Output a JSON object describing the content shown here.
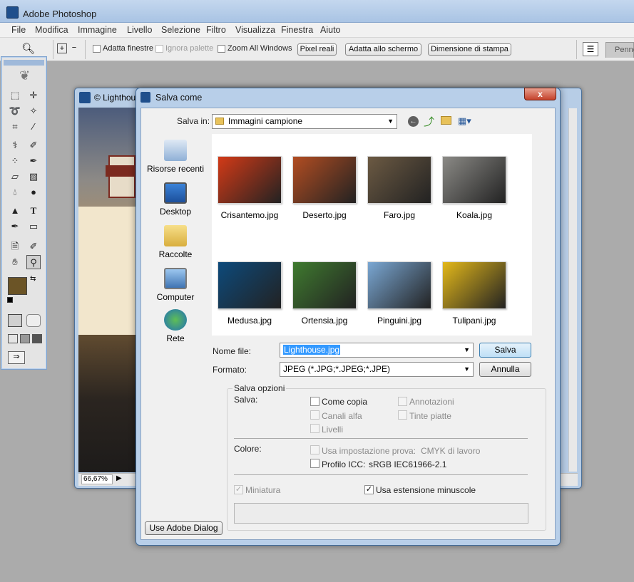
{
  "app": {
    "title": "Adobe Photoshop"
  },
  "menu": [
    "File",
    "Modifica",
    "Immagine",
    "Livello",
    "Selezione",
    "Filtro",
    "Visualizza",
    "Finestra",
    "Aiuto"
  ],
  "options": {
    "adatta_finestre": "Adatta finestre",
    "ignora_palette": "Ignora palette",
    "zoom_all": "Zoom All Windows",
    "pixel_reali": "Pixel reali",
    "adatta_schermo": "Adatta allo schermo",
    "dimensione_stampa": "Dimensione di stampa",
    "panel_tab": "Penne"
  },
  "document": {
    "title": "© Lighthou",
    "zoom": "66,67%"
  },
  "dialog": {
    "title": "Salva come",
    "save_in_label": "Salva in:",
    "save_in_value": "Immagini campione",
    "places": [
      "Risorse recenti",
      "Desktop",
      "Raccolte",
      "Computer",
      "Rete"
    ],
    "files": [
      {
        "name": "Crisantemo.jpg",
        "color": "#d33a17"
      },
      {
        "name": "Deserto.jpg",
        "color": "#b24d22"
      },
      {
        "name": "Faro.jpg",
        "color": "#6c5a43"
      },
      {
        "name": "Koala.jpg",
        "color": "#8b8a86"
      },
      {
        "name": "Medusa.jpg",
        "color": "#0d4a7b"
      },
      {
        "name": "Ortensia.jpg",
        "color": "#3f7a2f"
      },
      {
        "name": "Pinguini.jpg",
        "color": "#7aa7d3"
      },
      {
        "name": "Tulipani.jpg",
        "color": "#e3b81a"
      }
    ],
    "filename_label": "Nome file:",
    "filename_value": "Lighthouse.jpg",
    "format_label": "Formato:",
    "format_value": "JPEG (*.JPG;*.JPEG;*.JPE)",
    "save_button": "Salva",
    "cancel_button": "Annulla",
    "save_options_title": "Salva opzioni",
    "save_label": "Salva:",
    "come_copia": "Come copia",
    "annotazioni": "Annotazioni",
    "canali_alfa": "Canali alfa",
    "tinte_piatte": "Tinte piatte",
    "livelli": "Livelli",
    "colore_label": "Colore:",
    "usa_impostazione": "Usa impostazione prova:",
    "cmyk": "CMYK di lavoro",
    "profilo_icc": "Profilo ICC:",
    "profilo_value": "sRGB IEC61966-2.1",
    "miniatura": "Miniatura",
    "usa_estensione": "Usa estensione minuscole",
    "adobe_dialog_button": "Use Adobe Dialog",
    "close_glyph": "x"
  }
}
